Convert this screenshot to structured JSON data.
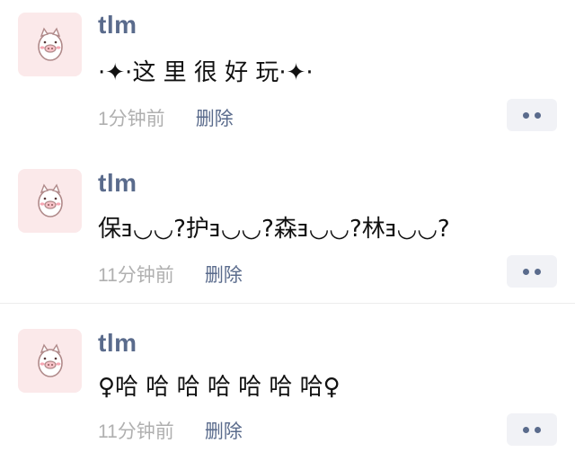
{
  "posts": [
    {
      "username": "tlm",
      "content": "·✦·这 里 很 好 玩·✦·",
      "time": "1分钟前",
      "delete_label": "删除",
      "avatar_icon": "pig-avatar-icon",
      "more_icon": "ellipsis-icon"
    },
    {
      "username": "tlm",
      "content": "保ⱻ◡◡?护ⱻ◡◡?森ⱻ◡◡?林ⱻ◡◡?",
      "time": "11分钟前",
      "delete_label": "删除",
      "avatar_icon": "pig-avatar-icon",
      "more_icon": "ellipsis-icon"
    },
    {
      "username": "tlm",
      "content": "♀哈 哈 哈 哈 哈 哈 哈♀",
      "time": "11分钟前",
      "delete_label": "删除",
      "avatar_icon": "pig-avatar-icon",
      "more_icon": "ellipsis-icon"
    }
  ],
  "colors": {
    "name": "#5a6b8c",
    "time": "#b0b0b0",
    "avatar_bg": "#fbe9ea",
    "more_bg": "#f1f2f6"
  }
}
